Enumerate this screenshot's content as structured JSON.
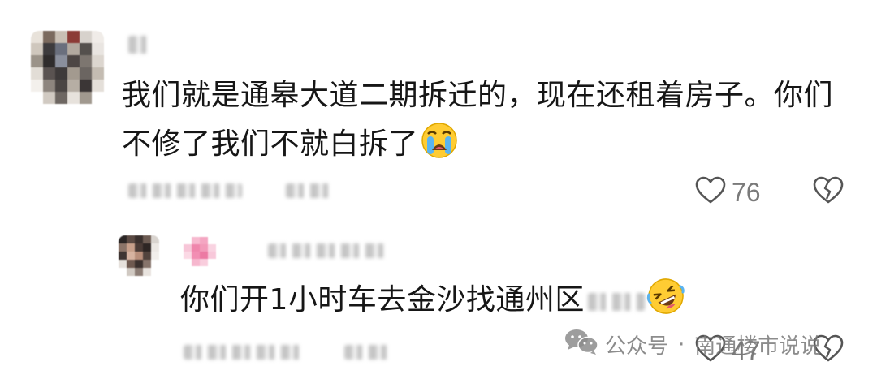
{
  "comment": {
    "text_line1": "我们就是通皋大道二期拆迁的，现在还租着房子。你们",
    "text_line2": "不修了我们不就白拆了",
    "emoji": "loudly-crying-face",
    "like_count": "76"
  },
  "reply": {
    "text": "你们开1小时车去金沙找通州区",
    "emoji": "rolling-on-floor-laughing-face",
    "like_count": "47"
  },
  "watermark": {
    "icon": "wechat-icon",
    "label": "公众号",
    "separator": "·",
    "account": "南通楼市说说"
  },
  "colors": {
    "text": "#161616",
    "meta": "#7a7a7a",
    "icon_stroke": "#555555"
  }
}
